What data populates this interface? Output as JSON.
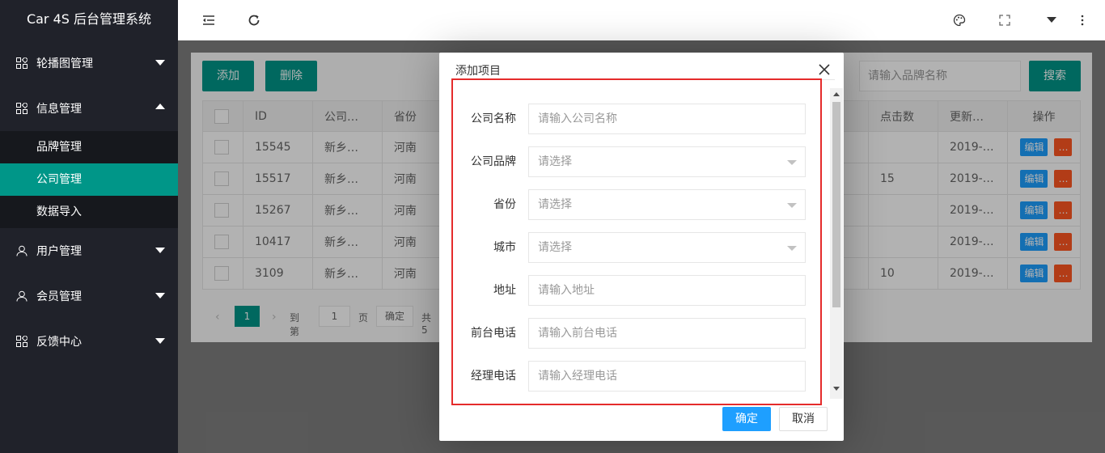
{
  "app": {
    "title": "Car 4S 后台管理系统"
  },
  "sidebar": {
    "items": [
      {
        "label": "轮播图管理",
        "icon": "grid-icon",
        "expanded": false
      },
      {
        "label": "信息管理",
        "icon": "grid-icon",
        "expanded": true,
        "children": [
          {
            "label": "品牌管理",
            "active": false
          },
          {
            "label": "公司管理",
            "active": true
          },
          {
            "label": "数据导入",
            "active": false
          }
        ]
      },
      {
        "label": "用户管理",
        "icon": "user-icon",
        "expanded": false
      },
      {
        "label": "会员管理",
        "icon": "user-icon",
        "expanded": false
      },
      {
        "label": "反馈中心",
        "icon": "grid-icon",
        "expanded": false
      }
    ]
  },
  "toolbar": {
    "add_label": "添加",
    "delete_label": "删除",
    "search_placeholder": "请输入品牌名称",
    "search_label": "搜索"
  },
  "table": {
    "headers": [
      "ID",
      "公司…",
      "省份",
      "点击数",
      "更新…",
      "操作"
    ],
    "rows": [
      {
        "id": "15545",
        "company": "新乡…",
        "province": "河南",
        "clicks": "",
        "updated": "2019-…"
      },
      {
        "id": "15517",
        "company": "新乡…",
        "province": "河南",
        "clicks": "15",
        "updated": "2019-…"
      },
      {
        "id": "15267",
        "company": "新乡…",
        "province": "河南",
        "clicks": "",
        "updated": "2019-…"
      },
      {
        "id": "10417",
        "company": "新乡…",
        "province": "河南",
        "clicks": "",
        "updated": "2019-…"
      },
      {
        "id": "3109",
        "company": "新乡…",
        "province": "河南",
        "clicks": "10",
        "updated": "2019-…"
      }
    ],
    "edit_label": "编辑",
    "more_label": "…"
  },
  "pager": {
    "current": "1",
    "goto_label": "到第",
    "goto_value": "1",
    "page_unit": "页",
    "confirm_label": "确定",
    "total_prefix": "共 5"
  },
  "dialog": {
    "title": "添加项目",
    "fields": [
      {
        "label": "公司名称",
        "placeholder": "请输入公司名称",
        "type": "input"
      },
      {
        "label": "公司品牌",
        "placeholder": "请选择",
        "type": "select"
      },
      {
        "label": "省份",
        "placeholder": "请选择",
        "type": "select"
      },
      {
        "label": "城市",
        "placeholder": "请选择",
        "type": "select"
      },
      {
        "label": "地址",
        "placeholder": "请输入地址",
        "type": "input"
      },
      {
        "label": "前台电话",
        "placeholder": "请输入前台电话",
        "type": "input"
      },
      {
        "label": "经理电话",
        "placeholder": "请输入经理电话",
        "type": "input"
      }
    ],
    "ok_label": "确定",
    "cancel_label": "取消"
  },
  "colors": {
    "sidebar_bg": "#20222a",
    "accent": "#009688",
    "primary_blue": "#1e9fff",
    "danger": "#ff5722",
    "highlight": "#e52b2b"
  }
}
